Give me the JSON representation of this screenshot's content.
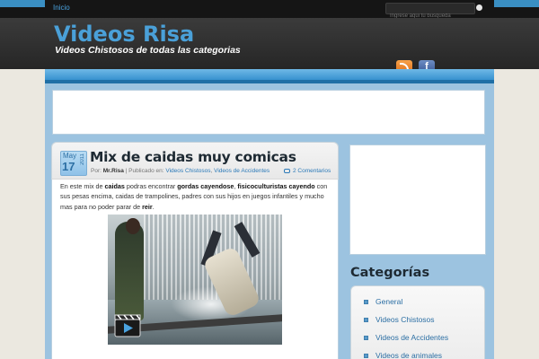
{
  "nav": {
    "home": "Inicio"
  },
  "search": {
    "placeholder": "Ingrese aqui tu busqueda"
  },
  "header": {
    "title": "Videos Risa",
    "tagline": "Videos Chistosos de todas las categorias",
    "fb_letter": "f"
  },
  "post": {
    "date": {
      "month": "May",
      "day": "17",
      "year": "2011"
    },
    "title": "Mix de caidas muy comicas",
    "meta": {
      "by_label": "Por:",
      "author": "Mr.Risa",
      "published_label": "| Publicado en:",
      "categories": [
        "Videos Chistosos",
        "Videos de Accidentes"
      ],
      "cat_sep": ","
    },
    "comments": "2 Comentarios",
    "body": [
      {
        "t": "En este mix de ",
        "b": false
      },
      {
        "t": "caidas",
        "b": true
      },
      {
        "t": " podras encontrar ",
        "b": false
      },
      {
        "t": "gordas cayendose",
        "b": true
      },
      {
        "t": ", ",
        "b": false
      },
      {
        "t": "fisicoculturistas cayendo",
        "b": true
      },
      {
        "t": " con sus pesas encima, caidas de trampolines, padres con sus hijos en juegos infantiles y mucho mas para no poder parar de ",
        "b": false
      },
      {
        "t": "reir",
        "b": true
      },
      {
        "t": ".",
        "b": false
      }
    ]
  },
  "sidebar": {
    "heading": "Categorías",
    "items": [
      "General",
      "Videos Chistosos",
      "Videos de Accidentes",
      "Videos de animales"
    ]
  },
  "colors": {
    "accent": "#3a8fc3",
    "title_blue": "#4aa0d8",
    "link": "#2c7ab8"
  }
}
